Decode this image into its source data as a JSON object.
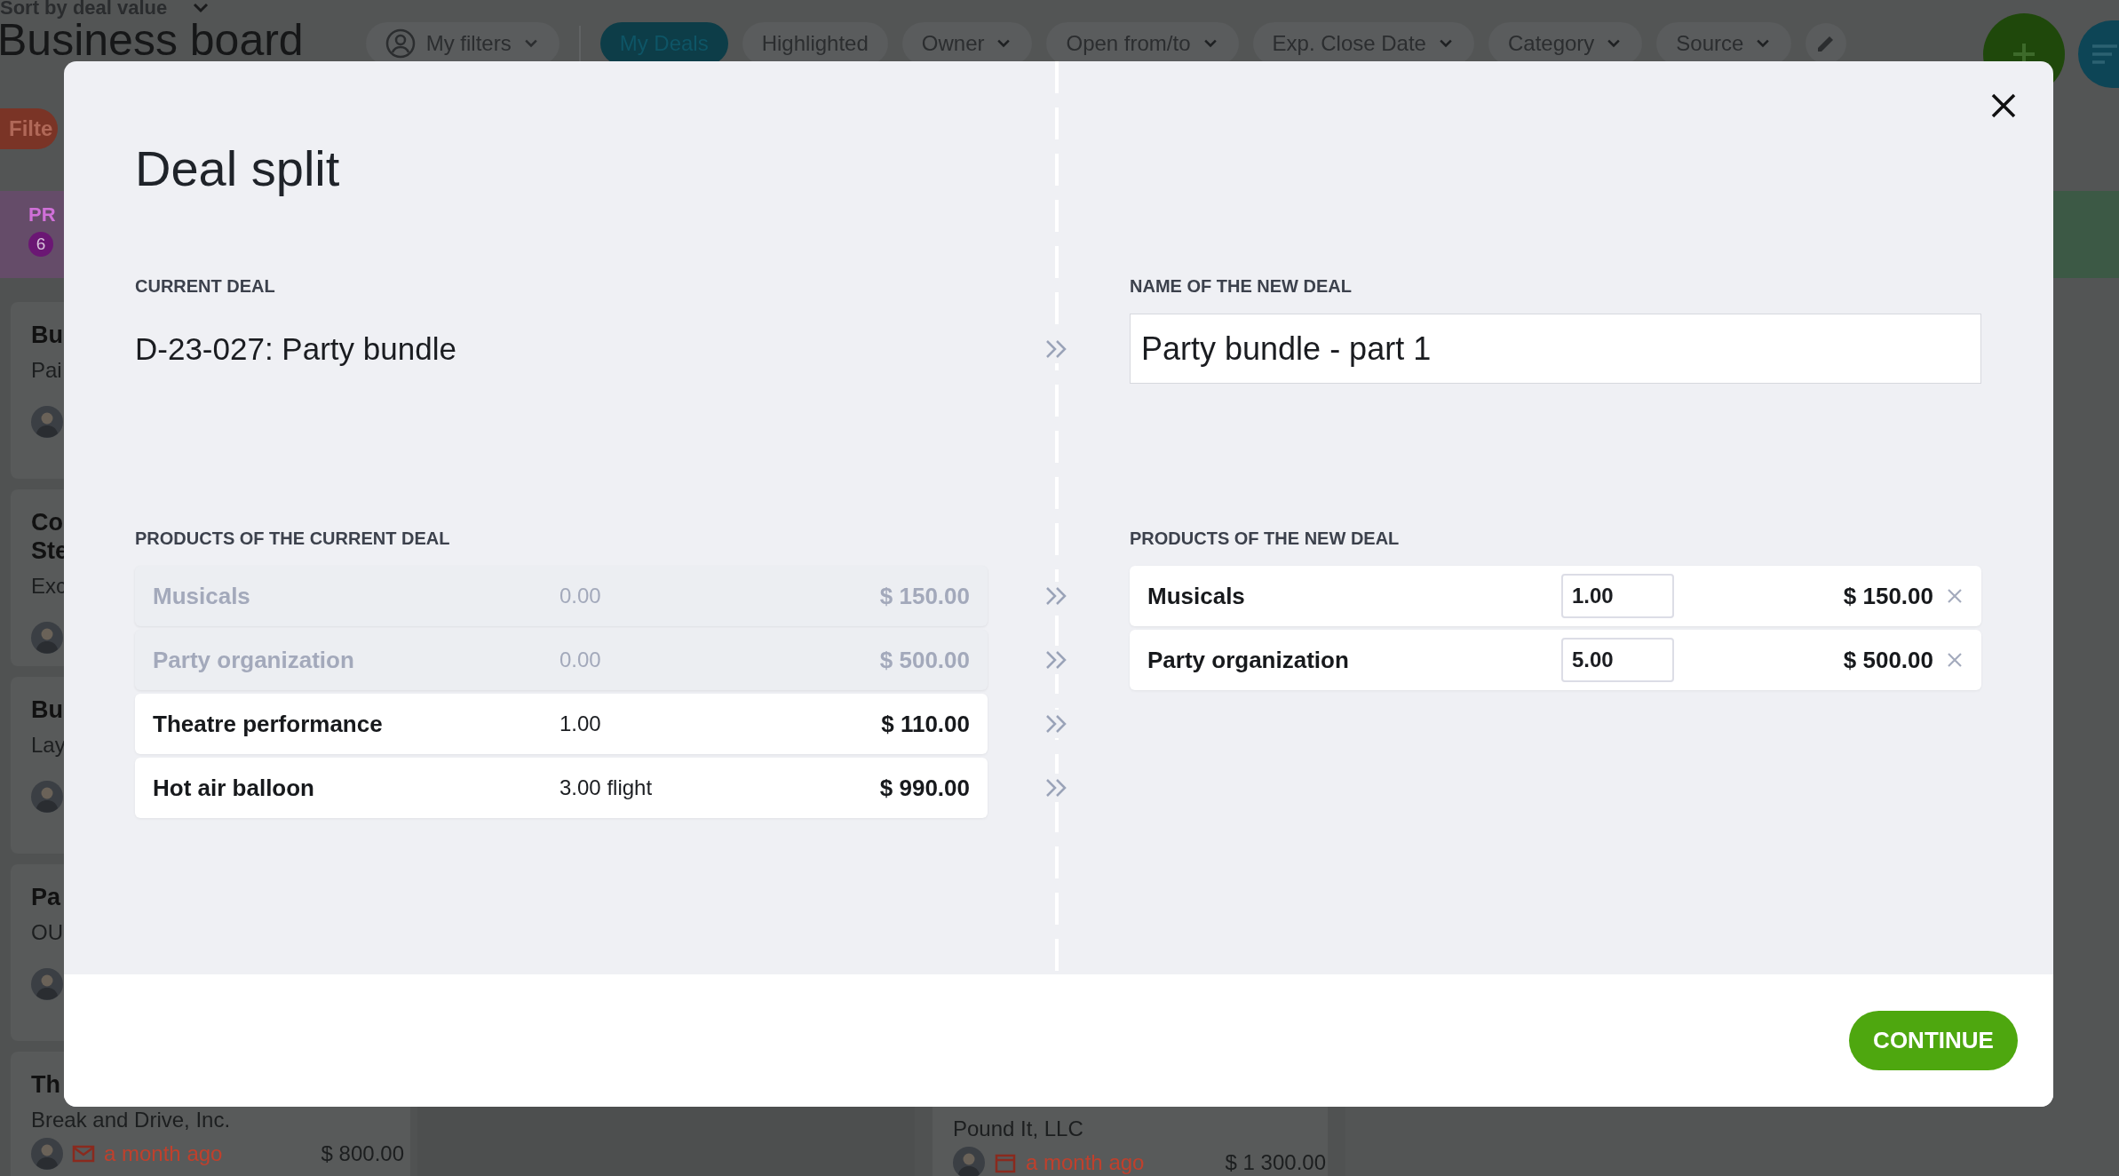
{
  "board": {
    "sort_label": "Sort by deal value",
    "title": "Business board",
    "my_filters": "My filters",
    "filters": [
      {
        "label": "My Deals",
        "selected": true,
        "kind": "plain"
      },
      {
        "label": "Highlighted",
        "selected": false,
        "kind": "plain"
      },
      {
        "label": "Owner",
        "selected": false,
        "kind": "dropdown"
      },
      {
        "label": "Open from/to",
        "selected": false,
        "kind": "dropdown"
      },
      {
        "label": "Exp. Close Date",
        "selected": false,
        "kind": "dropdown"
      },
      {
        "label": "Category",
        "selected": false,
        "kind": "dropdown"
      },
      {
        "label": "Source",
        "selected": false,
        "kind": "dropdown"
      }
    ],
    "filter_button": "Filte",
    "column": {
      "title": "PR",
      "count": "6"
    },
    "cards": [
      {
        "title": [
          "Bu"
        ],
        "subtitle": "Pai"
      },
      {
        "title": [
          "Co",
          "Ste"
        ],
        "subtitle": "Exc"
      },
      {
        "title": [
          "Bu"
        ],
        "subtitle": "Lay"
      },
      {
        "title": [
          "Pa"
        ],
        "subtitle": "OU"
      },
      {
        "title": [
          "Th"
        ],
        "subtitle": "Break and Drive, Inc.",
        "activity": "a month ago",
        "value": "$ 800.00"
      }
    ],
    "other_card": {
      "subtitle": "Pound It, LLC",
      "activity": "a month ago",
      "value": "$ 1 300.00"
    }
  },
  "modal": {
    "title": "Deal split",
    "current_label": "CURRENT DEAL",
    "current_deal": "D-23-027: Party bundle",
    "new_label": "NAME OF THE NEW DEAL",
    "new_name": "Party bundle - part 1",
    "current_products_label": "PRODUCTS OF THE CURRENT DEAL",
    "new_products_label": "PRODUCTS OF THE NEW DEAL",
    "current_products": [
      {
        "name": "Musicals",
        "quantity": "0.00",
        "price": "$ 150.00",
        "disabled": true
      },
      {
        "name": "Party organization",
        "quantity": "0.00",
        "price": "$ 500.00",
        "disabled": true
      },
      {
        "name": "Theatre performance",
        "quantity": "1.00",
        "price": "$ 110.00",
        "disabled": false
      },
      {
        "name": "Hot air balloon",
        "quantity": "3.00 flight",
        "price": "$ 990.00",
        "disabled": false
      }
    ],
    "new_products": [
      {
        "name": "Musicals",
        "quantity": "1.00",
        "price": "$ 150.00"
      },
      {
        "name": "Party organization",
        "quantity": "5.00",
        "price": "$ 500.00"
      }
    ],
    "continue": "CONTINUE"
  }
}
